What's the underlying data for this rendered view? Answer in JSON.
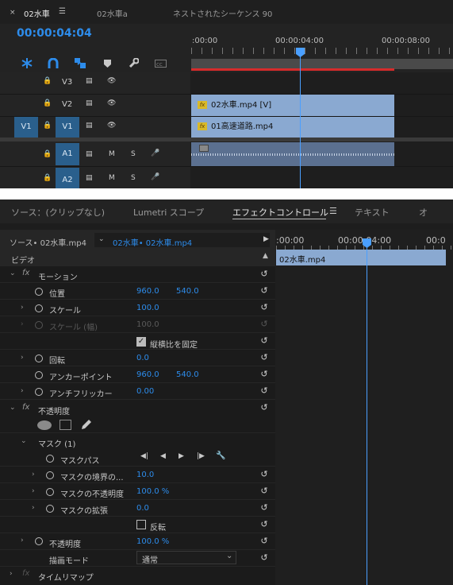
{
  "timeline": {
    "close": "×",
    "tab_active": "02水車",
    "menu": "☰",
    "tab2": "02水車a",
    "tab3": "ネストされたシーケンス 90",
    "timecode": "00:00:04:04",
    "ruler": [
      ":00:00",
      "00:00:04:00",
      "00:00:08:00"
    ],
    "tools": [
      "snap-icon",
      "linked-selection-icon",
      "add-marker-icon",
      "marker-icon",
      "wrench-icon",
      "captions-icon"
    ],
    "tracks": [
      {
        "source": "",
        "target": "V3",
        "sync": "▤",
        "eye": "👁"
      },
      {
        "source": "",
        "target": "V2",
        "sync": "▤",
        "eye": "👁"
      },
      {
        "source": "V1",
        "target": "V1",
        "sync": "▤",
        "eye": "👁"
      },
      {
        "source": "",
        "target": "A1",
        "sync": "▤",
        "m": "M",
        "s": "S",
        "mic": "🎤"
      },
      {
        "source": "",
        "target": "A2",
        "sync": "▤",
        "m": "M",
        "s": "S",
        "mic": "🎤"
      }
    ],
    "clips": {
      "v2": "02水車.mp4 [V]",
      "v1": "01高速道路.mp4",
      "fx": "fx"
    }
  },
  "effects": {
    "tabs": [
      "ソース：(クリップなし)",
      "Lumetri スコープ",
      "エフェクトコントロール",
      "テキスト",
      "オ"
    ],
    "menu": "☰",
    "source_label": "ソース• 02水車.mp4",
    "sequence_label": "02水車• 02水車.mp4",
    "play": "▶",
    "ruler": [
      ":00:00",
      "00:00:04:00",
      "00:0"
    ],
    "clip": "02水車.mp4",
    "video_header": "ビデオ",
    "fx": "fx",
    "reset": "↺",
    "motion": {
      "title": "モーション",
      "position": {
        "label": "位置",
        "x": "960.0",
        "y": "540.0"
      },
      "scale": {
        "label": "スケール",
        "value": "100.0"
      },
      "scale_width": {
        "label": "スケール (幅)",
        "value": "100.0"
      },
      "uniform": {
        "label": "縦横比を固定",
        "checked": true
      },
      "rotation": {
        "label": "回転",
        "value": "0.0"
      },
      "anchor": {
        "label": "アンカーポイント",
        "x": "960.0",
        "y": "540.0"
      },
      "flicker": {
        "label": "アンチフリッカー",
        "value": "0.00"
      }
    },
    "opacity": {
      "title": "不透明度",
      "mask": {
        "title": "マスク (1)",
        "path": "マスクパス",
        "path_controls": [
          "◀|",
          "◀",
          "▶",
          "|▶",
          "🔧"
        ],
        "feather": {
          "label": "マスクの境界の...",
          "value": "10.0"
        },
        "opacity": {
          "label": "マスクの不透明度",
          "value": "100.0 %"
        },
        "expansion": {
          "label": "マスクの拡張",
          "value": "0.0"
        },
        "inverted": {
          "label": "反転",
          "checked": false
        }
      },
      "opacity_value": {
        "label": "不透明度",
        "value": "100.0 %"
      },
      "blend": {
        "label": "描画モード",
        "value": "通常",
        "chevron": "⌄"
      }
    },
    "time_remap": "タイムリマップ"
  },
  "colors": {
    "accent": "#2d8ceb",
    "clip": "#8aa9d1",
    "target": "#2a5f8c",
    "playhead": "#4a9fff"
  }
}
